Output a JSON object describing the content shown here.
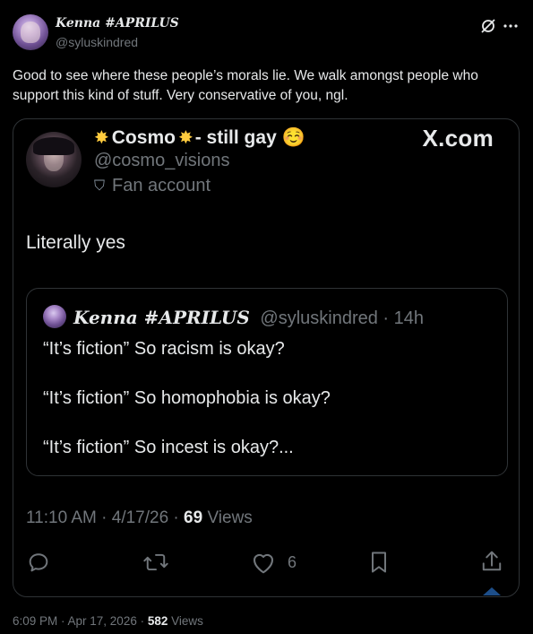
{
  "tweet": {
    "author_name": "Kenna #APRILUS",
    "author_handle": "@syluskindred",
    "text": "Good to see where these people’s morals lie. We walk amongst people who support this kind of stuff. Very conservative of you, ngl.",
    "footer_time": "6:09 PM · Apr 17, 2026 · ",
    "footer_views_count": "582",
    "footer_views_label": " Views"
  },
  "embed": {
    "author_name": "Cosmo",
    "author_suffix": " - still gay ☺️",
    "author_handle": "@cosmo_visions",
    "account_label": "Fan account",
    "brand": "X.com",
    "text": "Literally yes",
    "quoted": {
      "author_name": "Kenna #APRILUS",
      "author_handle": "@syluskindred",
      "time": "· 14h",
      "lines": [
        "“It’s fiction” So racism is okay?",
        "“It’s fiction” So homophobia is okay?",
        "“It’s fiction” So incest is okay?..."
      ]
    },
    "meta_time": "11:10 AM · 4/17/26 · ",
    "meta_views_count": "69",
    "meta_views_label": " Views",
    "like_count": "6"
  },
  "colors": {
    "background": "#000000",
    "text": "#e7e9ea",
    "muted": "#71767b",
    "border": "#2f3336",
    "accent": "#1d9bf0"
  },
  "icons": [
    "grok-icon",
    "more-icon",
    "reply-icon",
    "retweet-icon",
    "like-icon",
    "bookmark-icon",
    "share-icon",
    "theater-masks-icon",
    "star-emoji-icon"
  ]
}
